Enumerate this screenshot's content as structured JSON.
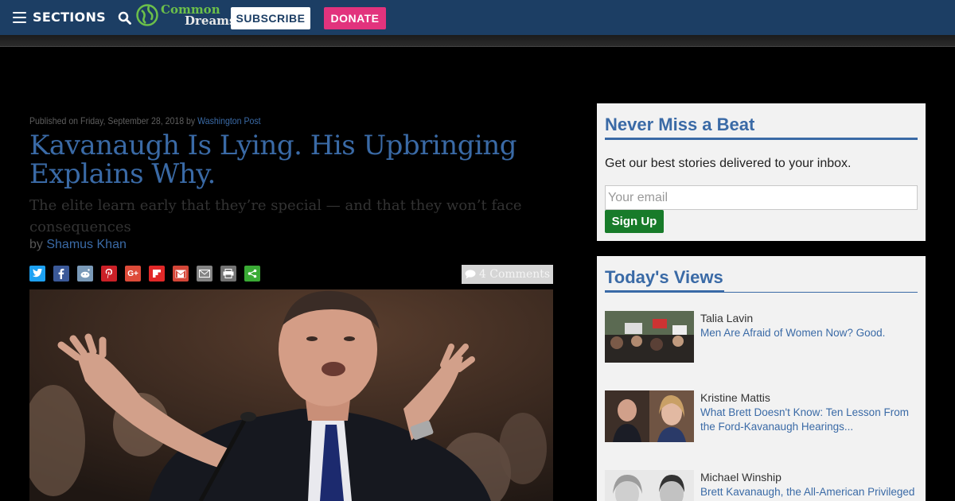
{
  "header": {
    "menu_label": "SECTIONS",
    "logo_line1": "Common",
    "logo_line2": "Dreams",
    "subscribe_label": "SUBSCRIBE",
    "donate_label": "DONATE",
    "colors": {
      "bar": "#1c3e64",
      "donate": "#e2337d",
      "logo_green": "#6cc04a"
    }
  },
  "article": {
    "published_prefix": "Published on Friday, September 28, 2018 by",
    "source": "Washington Post",
    "title": "Kavanaugh Is Lying. His Upbringing Explains Why.",
    "subtitle": "The elite learn early that they’re special — and that they won’t face consequences",
    "by_prefix": "by",
    "author": "Shamus Khan",
    "comments_label": "4 Comments",
    "share_icons": [
      "twitter-icon",
      "facebook-icon",
      "reddit-icon",
      "pinterest-icon",
      "google-plus-icon",
      "flipboard-icon",
      "gmail-icon",
      "email-icon",
      "print-icon",
      "more-share-icon"
    ]
  },
  "newsletter": {
    "title": "Never Miss a Beat",
    "description": "Get our best stories delivered to your inbox.",
    "email_placeholder": "Your email",
    "button_label": "Sign Up"
  },
  "todays_views": {
    "title": "Today's Views",
    "items": [
      {
        "author": "Talia Lavin",
        "headline": "Men Are Afraid of Women Now? Good."
      },
      {
        "author": "Kristine Mattis",
        "headline": "What Brett Doesn't Know: Ten Lesson From the Ford-Kavanaugh Hearings..."
      },
      {
        "author": "Michael Winship",
        "headline": "Brett Kavanaugh, the All-American Privileged"
      }
    ]
  }
}
